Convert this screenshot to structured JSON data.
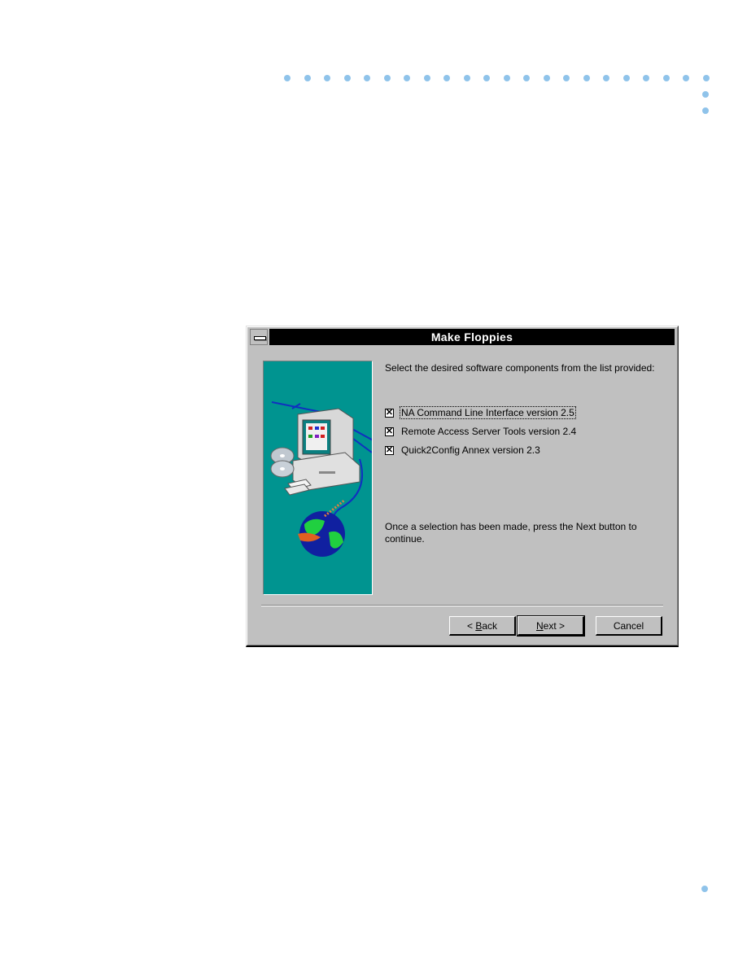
{
  "decorations": {
    "dot_color": "#8fc3ea"
  },
  "dialog": {
    "title": "Make Floppies",
    "system_menu_icon": "system-menu-icon",
    "instruction": "Select the desired software components from the list provided:",
    "components": [
      {
        "label": "NA Command Line Interface version 2.5",
        "checked": true,
        "focused": true
      },
      {
        "label": "Remote Access Server Tools version 2.4",
        "checked": true,
        "focused": false
      },
      {
        "label": "Quick2Config Annex version 2.3",
        "checked": true,
        "focused": false
      }
    ],
    "footer_text": "Once a selection has been made, press the Next button to continue.",
    "buttons": {
      "back": {
        "prefix": "< ",
        "accel": "B",
        "rest": "ack"
      },
      "next": {
        "prefix": "",
        "accel": "N",
        "rest": "ext >"
      },
      "cancel": "Cancel"
    },
    "illustration": "computer-network-globe-illustration",
    "teal_color": "#009490"
  }
}
